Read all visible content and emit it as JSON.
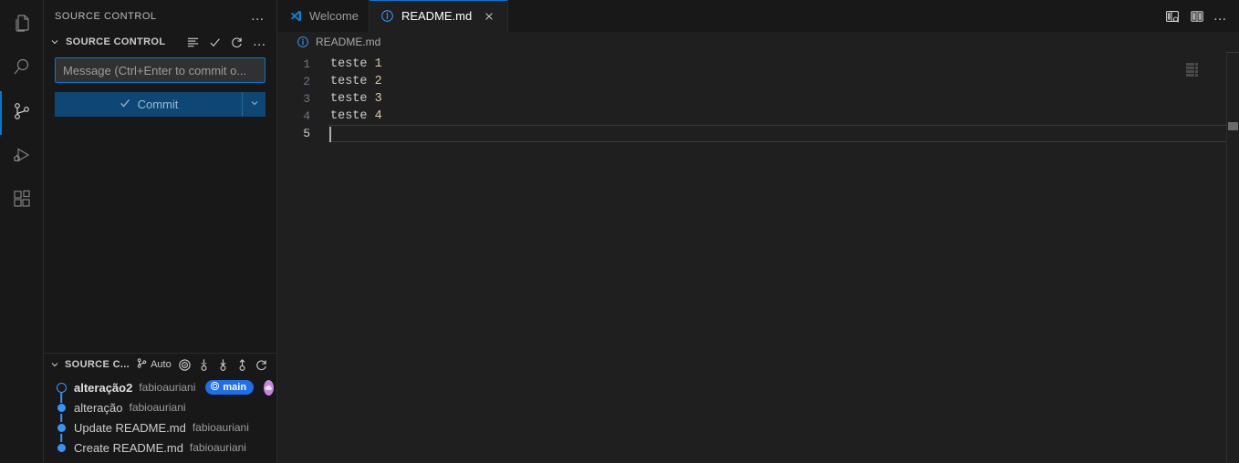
{
  "activitybar": {
    "items": [
      {
        "name": "explorer",
        "title": "Explorer",
        "icon": "files-icon",
        "active": false
      },
      {
        "name": "search",
        "title": "Search",
        "icon": "search-icon",
        "active": false
      },
      {
        "name": "source-control",
        "title": "Source Control",
        "icon": "source-control-icon",
        "active": true
      },
      {
        "name": "run-debug",
        "title": "Run and Debug",
        "icon": "run-debug-icon",
        "active": false
      },
      {
        "name": "extensions",
        "title": "Extensions",
        "icon": "extensions-icon",
        "active": false
      }
    ]
  },
  "sidebar": {
    "view_title": "SOURCE CONTROL",
    "view_more_label": "…",
    "scm": {
      "section_label": "SOURCE CONTROL",
      "actions": [
        {
          "name": "view-as-tree",
          "icon": "list-icon",
          "label": "View as Tree"
        },
        {
          "name": "commit",
          "icon": "check-icon",
          "label": "Commit"
        },
        {
          "name": "refresh",
          "icon": "refresh-icon",
          "label": "Refresh"
        },
        {
          "name": "more",
          "icon": "ellipsis-icon",
          "label": "Views and More Actions..."
        }
      ],
      "message_placeholder": "Message (Ctrl+Enter to commit o...",
      "message_value": "",
      "commit_label": "Commit",
      "commit_dropdown_label": "Commit Actions"
    },
    "graph": {
      "section_label": "SOURCE C...",
      "auto_label": "Auto",
      "actions": [
        {
          "name": "graph-target",
          "icon": "target-icon",
          "label": "Go to HEAD"
        },
        {
          "name": "fetch",
          "icon": "fetch-icon",
          "label": "Fetch"
        },
        {
          "name": "pull",
          "icon": "pull-icon",
          "label": "Pull"
        },
        {
          "name": "push",
          "icon": "push-icon",
          "label": "Push"
        },
        {
          "name": "graph-refresh",
          "icon": "refresh-icon",
          "label": "Refresh"
        }
      ],
      "commits": [
        {
          "message": "alteração2",
          "author": "fabioauriani",
          "is_head": true,
          "badge": "main",
          "has_avatar": true
        },
        {
          "message": "alteração",
          "author": "fabioauriani",
          "is_head": false,
          "badge": "",
          "has_avatar": false
        },
        {
          "message": "Update README.md",
          "author": "fabioauriani",
          "is_head": false,
          "badge": "",
          "has_avatar": false
        },
        {
          "message": "Create README.md",
          "author": "fabioauriani",
          "is_head": false,
          "badge": "",
          "has_avatar": false
        }
      ]
    }
  },
  "editor": {
    "tabs": [
      {
        "label": "Welcome",
        "icon": "vscode-logo-icon",
        "active": false,
        "closable": false
      },
      {
        "label": "README.md",
        "icon": "markdown-info-icon",
        "active": true,
        "closable": true
      }
    ],
    "tab_actions": [
      {
        "name": "open-preview",
        "icon": "open-preview-icon",
        "label": "Open Preview to the Side"
      },
      {
        "name": "split-editor",
        "icon": "split-editor-icon",
        "label": "Split Editor Right"
      },
      {
        "name": "editor-more",
        "icon": "ellipsis-icon",
        "label": "More Actions..."
      }
    ],
    "breadcrumb": {
      "icon": "markdown-info-icon",
      "label": "README.md"
    },
    "code": {
      "lines": [
        {
          "number": "1",
          "text": "teste ",
          "num_token": "1"
        },
        {
          "number": "2",
          "text": "teste ",
          "num_token": "2"
        },
        {
          "number": "3",
          "text": "teste ",
          "num_token": "3"
        },
        {
          "number": "4",
          "text": "teste ",
          "num_token": "4"
        },
        {
          "number": "5",
          "text": "",
          "num_token": ""
        }
      ],
      "cursor_line": "5"
    }
  },
  "colors": {
    "accent": "#0078d4",
    "graph_node": "#3794ff",
    "badge_bg": "#1f6feb",
    "avatar_bg": "#c586e0",
    "commit_button_bg": "#0e4775",
    "editor_bg": "#1f1f1f",
    "chrome_bg": "#181818"
  }
}
